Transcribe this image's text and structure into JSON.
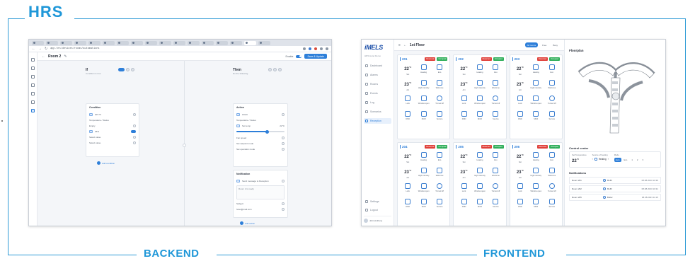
{
  "diagram": {
    "title": "HRS",
    "left_caption": "BACKEND",
    "right_caption": "FRONTEND"
  },
  "backend": {
    "url": "app.hrs/devices/rooms/automations",
    "header": {
      "title": "Room 2",
      "enable_label": "Enable",
      "save_button": "Save & Update"
    },
    "if_column": {
      "title": "If",
      "subtitle": "Condition is true",
      "conditions_card": {
        "title": "Condition",
        "row1_label": "HP-TV",
        "section_label": "Temperature / Status",
        "row2_label": "Empty",
        "row3_label": "25%",
        "row4_label": "Select value",
        "row5_label": "Select value"
      },
      "add_label": "Add condition"
    },
    "then_column": {
      "title": "Then",
      "subtitle": "Do the following",
      "action_card": {
        "title": "Action",
        "row1_label": "HVAC",
        "section_label": "Temperature / Status",
        "row2_label": "Set temp",
        "row2_value": "22°C",
        "row3_label": "Fan speed",
        "row4_label": "Set setpoint mode",
        "row5_label": "Set operation mode"
      },
      "notif_card": {
        "title": "Notification",
        "row1_label": "Send message to Reception",
        "message": "Room 2 is ready",
        "row2_label": "Subject",
        "row3_label": "hotel@mail.com"
      },
      "add_label": "Add action"
    }
  },
  "frontend": {
    "logo": "iMELS",
    "brand_sub": "HRS Hotel Demo",
    "nav": [
      "Dashboard",
      "Alarms",
      "Rooms",
      "Events",
      "Log",
      "Scenarios",
      "Reception"
    ],
    "bottom_nav": [
      "Settings",
      "Logout"
    ],
    "user": "John Anthony",
    "topbar": {
      "title": "1st Floor",
      "pills": [
        "All rooms",
        "Free",
        "Busy"
      ]
    },
    "rooms": [
      {
        "number": "201"
      },
      {
        "number": "202"
      },
      {
        "number": "203"
      },
      {
        "number": "204"
      },
      {
        "number": "205"
      },
      {
        "number": "206"
      }
    ],
    "room_badges": {
      "reserved": "Reserved",
      "occupied": "Occupied"
    },
    "cell_labels": {
      "row1": [
        "Set",
        "Heating",
        "Eco"
      ],
      "row2": [
        "Act",
        "High intensity",
        "Welcome"
      ],
      "row3": [
        "Lock",
        "Window open",
        "Turned off"
      ],
      "row4": [
        "DND",
        "MUR",
        "Service"
      ]
    },
    "temps": {
      "set": "22",
      "act": "23",
      "unit": "°C"
    },
    "floorplan_title": "Floorplan",
    "control_center": {
      "title": "Control center",
      "temp_label": "Set Temperature",
      "temp_value": "22",
      "temp_unit": "°C",
      "heat_label": "Source of heating",
      "heat_value": "Heating",
      "mode_label": "Mode",
      "modes": [
        "Auto",
        "Eco",
        "1",
        "2",
        "3"
      ]
    },
    "notifications": {
      "title": "Notifications",
      "items": [
        {
          "room": "Room 201",
          "who": "MUR",
          "when": "08.08.2023 10:30"
        },
        {
          "room": "Room 202",
          "who": "MUR",
          "when": "08.08.2023 10:31"
        },
        {
          "room": "Room 205",
          "who": "Butler",
          "when": "08.08.2023 11:15"
        }
      ]
    }
  },
  "colors": {
    "accent": "#1f97d8",
    "primary": "#2e7fd9",
    "reserved": "#e0403a",
    "occupied": "#2fae5a"
  }
}
